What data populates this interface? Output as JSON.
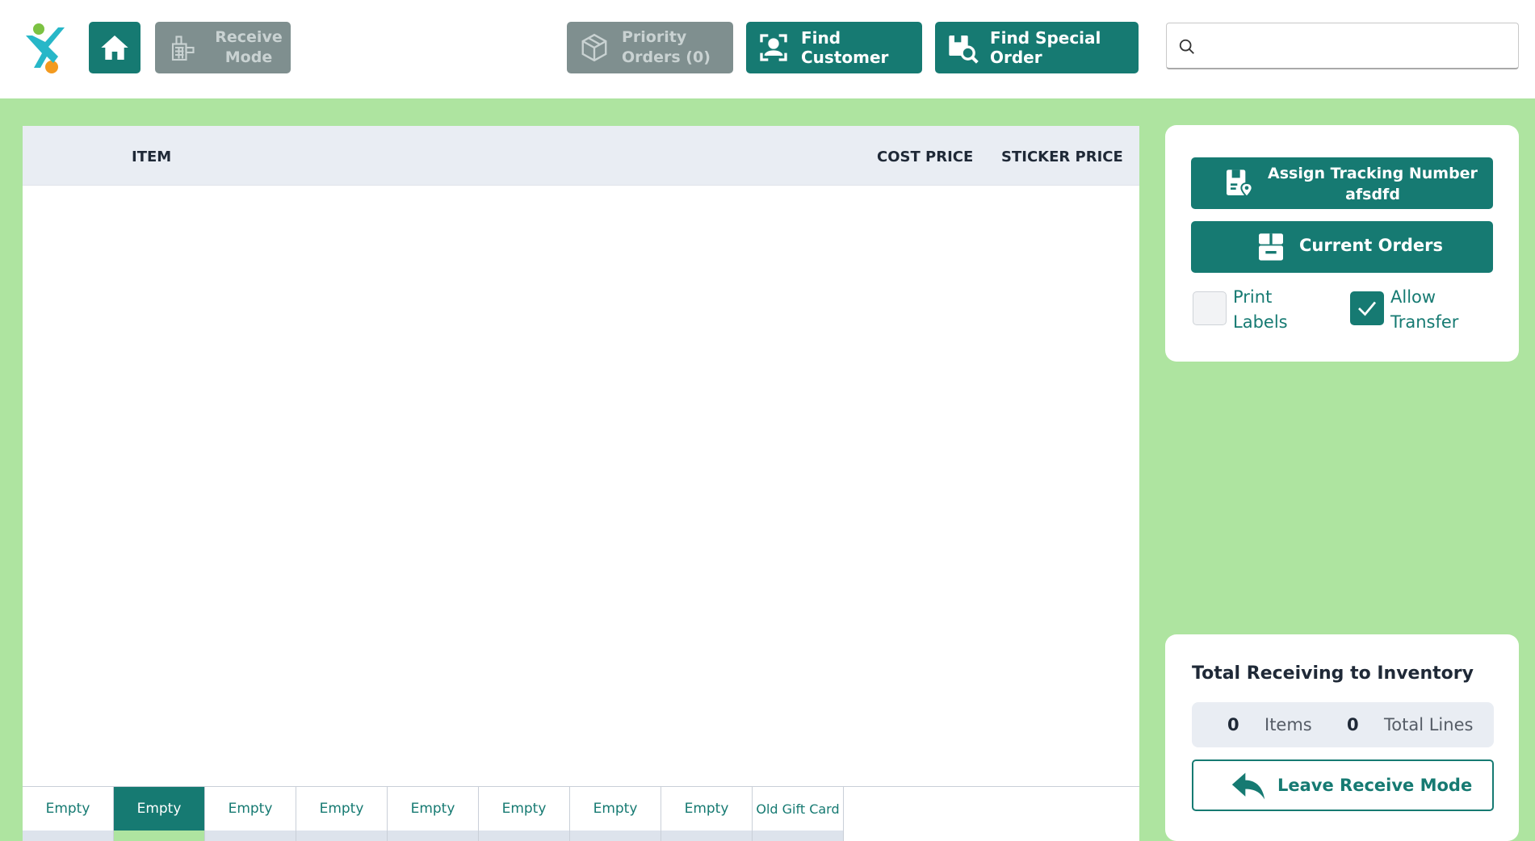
{
  "header": {
    "receive_mode_label": "Receive Mode",
    "priority_orders_label": "Priority Orders (0)",
    "find_customer_label": "Find Customer",
    "find_special_order_label": "Find Special Order",
    "search_value": ""
  },
  "table": {
    "columns": [
      "ITEM",
      "COST PRICE",
      "STICKER PRICE"
    ],
    "rows": []
  },
  "tabs": [
    "Empty",
    "Empty",
    "Empty",
    "Empty",
    "Empty",
    "Empty",
    "Empty",
    "Empty",
    "Old Gift Card"
  ],
  "active_tab_index": 1,
  "side": {
    "assign_tracking_label": "Assign Tracking Number",
    "tracking_number": "afsdfd",
    "current_orders_label": "Current Orders",
    "print_labels_label": "Print Labels",
    "print_labels_checked": false,
    "allow_transfer_label": "Allow Transfer",
    "allow_transfer_checked": true
  },
  "totals": {
    "title": "Total Receiving to Inventory",
    "items_value": "0",
    "items_label": "Items",
    "lines_value": "0",
    "lines_label": "Total Lines"
  },
  "leave_button_label": "Leave Receive Mode",
  "colors": {
    "accent": "#167a72",
    "background_green": "#aee4a0",
    "disabled_gray": "#7f8f8f",
    "header_row": "#e9edf3"
  },
  "icons": {
    "logo": "brand-logo",
    "home": "home-icon",
    "receive": "cash-register-icon",
    "priority": "box-icon",
    "find_customer": "user-scan-icon",
    "find_special_order": "package-search-icon",
    "search": "search-icon",
    "assign_tracking": "tracking-tag-icon",
    "current_orders": "archive-box-icon",
    "leave": "reply-arrow-icon"
  }
}
